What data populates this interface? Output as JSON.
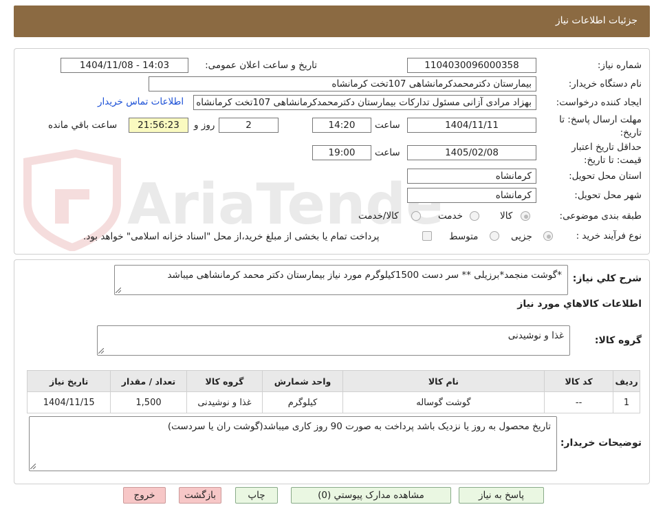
{
  "header": {
    "title": "جزئیات اطلاعات نیاز"
  },
  "watermark": {
    "text": "AriaTender.neT"
  },
  "form": {
    "need_number_label": "شماره نیاز:",
    "need_number": "1104030096000358",
    "announce_label": "تاریخ و ساعت اعلان عمومی:",
    "announce_value": "1404/11/08 - 14:03",
    "buyer_org_label": "نام دستگاه خریدار:",
    "buyer_org": "بیمارستان دکترمحمدکرمانشاهی 107تخت کرمانشاه",
    "creator_label": "ایجاد کننده درخواست:",
    "creator": "بهزاد مرادی آزانی مسئول تدارکات بیمارستان دکترمحمدکرمانشاهی 107تخت کرمانشاه",
    "contact_link": "اطلاعات تماس خریدار",
    "deadline_label": "مهلت ارسال پاسخ: تا تاریخ:",
    "deadline_date": "1404/11/11",
    "time_word": "ساعت",
    "deadline_time": "14:20",
    "days_value": "2",
    "days_word": "روز و",
    "remaining_time": "21:56:23",
    "remaining_word": "ساعت باقي مانده",
    "validity_label": "حداقل تاریخ اعتبار قیمت: تا تاریخ:",
    "validity_date": "1405/02/08",
    "validity_time": "19:00",
    "province_label": "استان محل تحویل:",
    "province": "کرمانشاه",
    "city_label": "شهر محل تحویل:",
    "city": "کرمانشاه",
    "category_label": "طبقه بندی موضوعی:",
    "category_options": [
      "کالا",
      "خدمت",
      "کالا/خدمت"
    ],
    "process_label": "نوع فرآیند خرید :",
    "process_options": [
      "جزیی",
      "متوسط"
    ],
    "payment_note": "پرداخت تمام یا بخشی از مبلغ خرید،از محل \"اسناد خزانه اسلامی\" خواهد بود."
  },
  "summary": {
    "label": "شرح کلي نياز:",
    "text": "*گوشت منجمد*برزیلی ** سر دست 1500کیلوگرم مورد نیاز بیمارستان دکتر محمد کرمانشاهی میباشد"
  },
  "goods_section": {
    "title": "اطلاعات کالاهاي مورد نياز",
    "group_label": "گروه کالا:",
    "group_value": "غذا و نوشیدنی"
  },
  "table": {
    "headers": [
      "ردیف",
      "کد کالا",
      "نام کالا",
      "واحد شمارش",
      "گروه کالا",
      "تعداد / مقدار",
      "تاریخ نیاز"
    ],
    "rows": [
      [
        "1",
        "--",
        "گوشت گوساله",
        "کیلوگرم",
        "غذا و نوشیدنی",
        "1,500",
        "1404/11/15"
      ]
    ]
  },
  "buyer_notes": {
    "label": "توضیحات خریدار:",
    "text": "تاریخ محصول به روز یا نزدیک باشد پرداخت به صورت 90 روز کاری میباشد(گوشت ران یا   سردست)"
  },
  "buttons": {
    "respond": "پاسخ به نیاز",
    "attachments": "مشاهده مدارک پیوستي (0)",
    "print": "چاپ",
    "back": "بازگشت",
    "exit": "خروج"
  }
}
